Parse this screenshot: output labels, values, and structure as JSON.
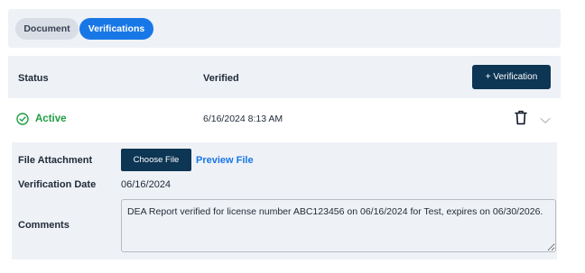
{
  "tabs": [
    {
      "label": "Document",
      "active": false
    },
    {
      "label": "Verifications",
      "active": true
    }
  ],
  "table": {
    "headers": {
      "status": "Status",
      "verified": "Verified"
    },
    "add_button_label": "+ Verification"
  },
  "record": {
    "status": "Active",
    "verified": "6/16/2024 8:13 AM",
    "icons": [
      "check-circle-icon",
      "trash-icon",
      "chevron-down-icon"
    ]
  },
  "detail": {
    "file_attachment_label": "File Attachment",
    "choose_file_label": "Choose File",
    "preview_file_label": "Preview File",
    "verification_date_label": "Verification Date",
    "verification_date": "06/16/2024",
    "comments_label": "Comments",
    "comments": "DEA Report verified for license number ABC123456 on 06/16/2024 for Test, expires on 06/30/2026."
  },
  "colors": {
    "accent": "#1877e6",
    "primary_button": "#0d3554",
    "status_active": "#1e9e43",
    "panel_bg": "#eef1f6"
  }
}
